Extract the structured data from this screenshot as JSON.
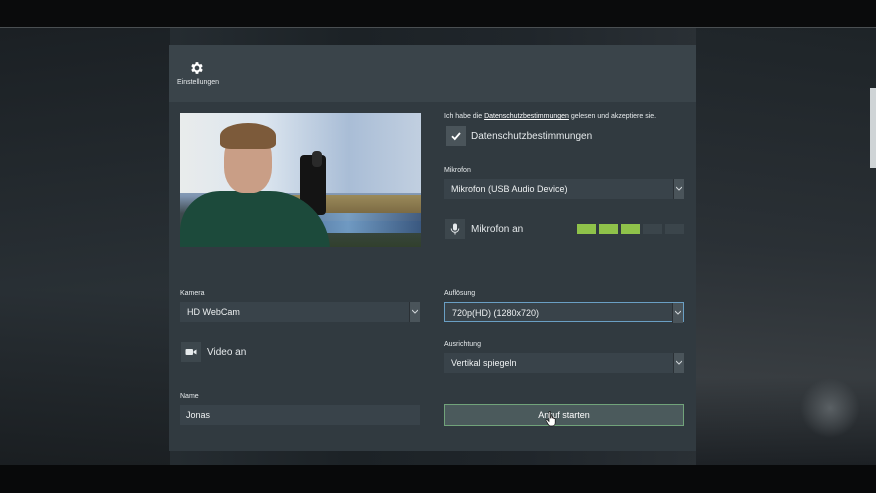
{
  "header": {
    "settings_label": "Einstellungen",
    "settings_icon": "gear-icon"
  },
  "privacy": {
    "text_before": "Ich habe die ",
    "link_text": "Datenschutzbestimmungen",
    "text_after": " gelesen und akzeptiere sie.",
    "checkbox_label": "Datenschutzbestimmungen",
    "checked": true
  },
  "mic": {
    "label": "Mikrofon",
    "selected": "Mikrofon (USB Audio Device)",
    "toggle_label": "Mikrofon an",
    "toggle_icon": "microphone-icon",
    "level_active": 3,
    "level_total": 5,
    "level_active_color": "#8fc24a",
    "level_inactive_color": "#3b454b"
  },
  "camera": {
    "label": "Kamera",
    "selected": "HD WebCam",
    "toggle_label": "Video an",
    "toggle_icon": "video-camera-icon"
  },
  "resolution": {
    "label": "Auflösung",
    "selected": "720p(HD) (1280x720)"
  },
  "orientation": {
    "label": "Ausrichtung",
    "selected": "Vertikal spiegeln"
  },
  "name": {
    "label": "Name",
    "value": "Jonas"
  },
  "start_button": {
    "label": "Anruf starten",
    "border_color": "#71a37a"
  }
}
